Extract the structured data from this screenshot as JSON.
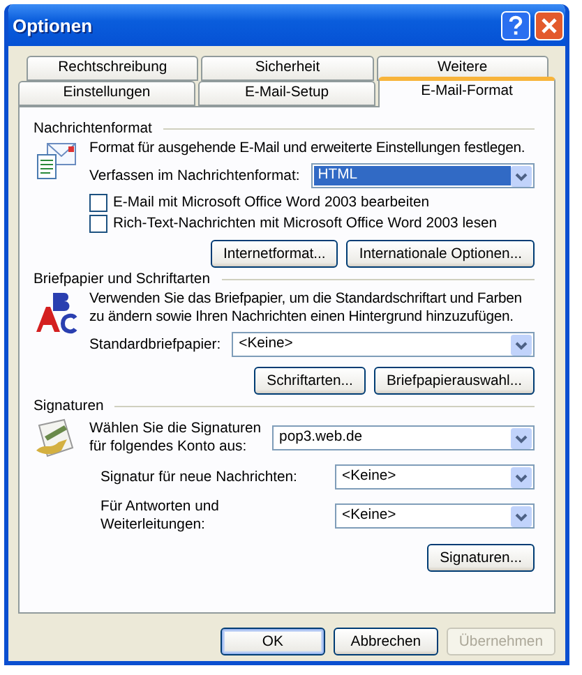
{
  "window": {
    "title": "Optionen"
  },
  "tab_rows": [
    [
      {
        "label": "Rechtschreibung",
        "selected": false
      },
      {
        "label": "Sicherheit",
        "selected": false
      },
      {
        "label": "Weitere",
        "selected": false
      }
    ],
    [
      {
        "label": "Einstellungen",
        "selected": false
      },
      {
        "label": "E-Mail-Setup",
        "selected": false
      },
      {
        "label": "E-Mail-Format",
        "selected": true
      }
    ]
  ],
  "sections": [
    {
      "title": "Nachrichtenformat",
      "kind": "envelope",
      "description": "Format für ausgehende E-Mail und erweiterte Einstellungen festlegen.",
      "controls": [
        {
          "kind": "dropdown",
          "label": "Verfassen im Nachrichtenformat:",
          "value": "HTML",
          "selected": true
        },
        {
          "kind": "checkbox",
          "label": "E-Mail mit Microsoft Office Word 2003 bearbeiten",
          "checked": false
        },
        {
          "kind": "checkbox",
          "label": "Rich-Text-Nachrichten mit Microsoft Office Word 2003 lesen",
          "checked": false
        },
        {
          "kind": "buttons",
          "buttons": [
            "Internetformat...",
            "Internationale Optionen..."
          ]
        }
      ]
    },
    {
      "title": "Briefpapier und Schriftarten",
      "kind": "letters",
      "description": "Verwenden Sie das Briefpapier, um die Standardschriftart und Farben zu ändern sowie Ihren Nachrichten einen Hintergrund hinzuzufügen.",
      "controls": [
        {
          "kind": "dropdown",
          "label": "Standardbriefpapier:",
          "value": "<Keine>",
          "selected": false
        },
        {
          "kind": "buttons",
          "buttons": [
            "Schriftarten...",
            "Briefpapierauswahl..."
          ]
        }
      ]
    },
    {
      "title": "Signaturen",
      "kind": "signature",
      "controls": [
        {
          "kind": "dropdown",
          "label": "Wählen Sie die Signaturen\nfür folgendes Konto aus:",
          "value": "pop3.web.de",
          "selected": false
        },
        {
          "kind": "subdropdown",
          "label": "Signatur für neue Nachrichten:",
          "value": "<Keine>",
          "selected": false
        },
        {
          "kind": "subdropdown",
          "label": "Für Antworten und Weiterleitungen:",
          "value": "<Keine>",
          "selected": false
        },
        {
          "kind": "buttons",
          "buttons": [
            "Signaturen..."
          ]
        }
      ]
    }
  ],
  "footer": [
    {
      "label": "OK",
      "default": true,
      "disabled": false
    },
    {
      "label": "Abbrechen",
      "default": false,
      "disabled": false
    },
    {
      "label": "Übernehmen",
      "default": false,
      "disabled": true
    }
  ]
}
